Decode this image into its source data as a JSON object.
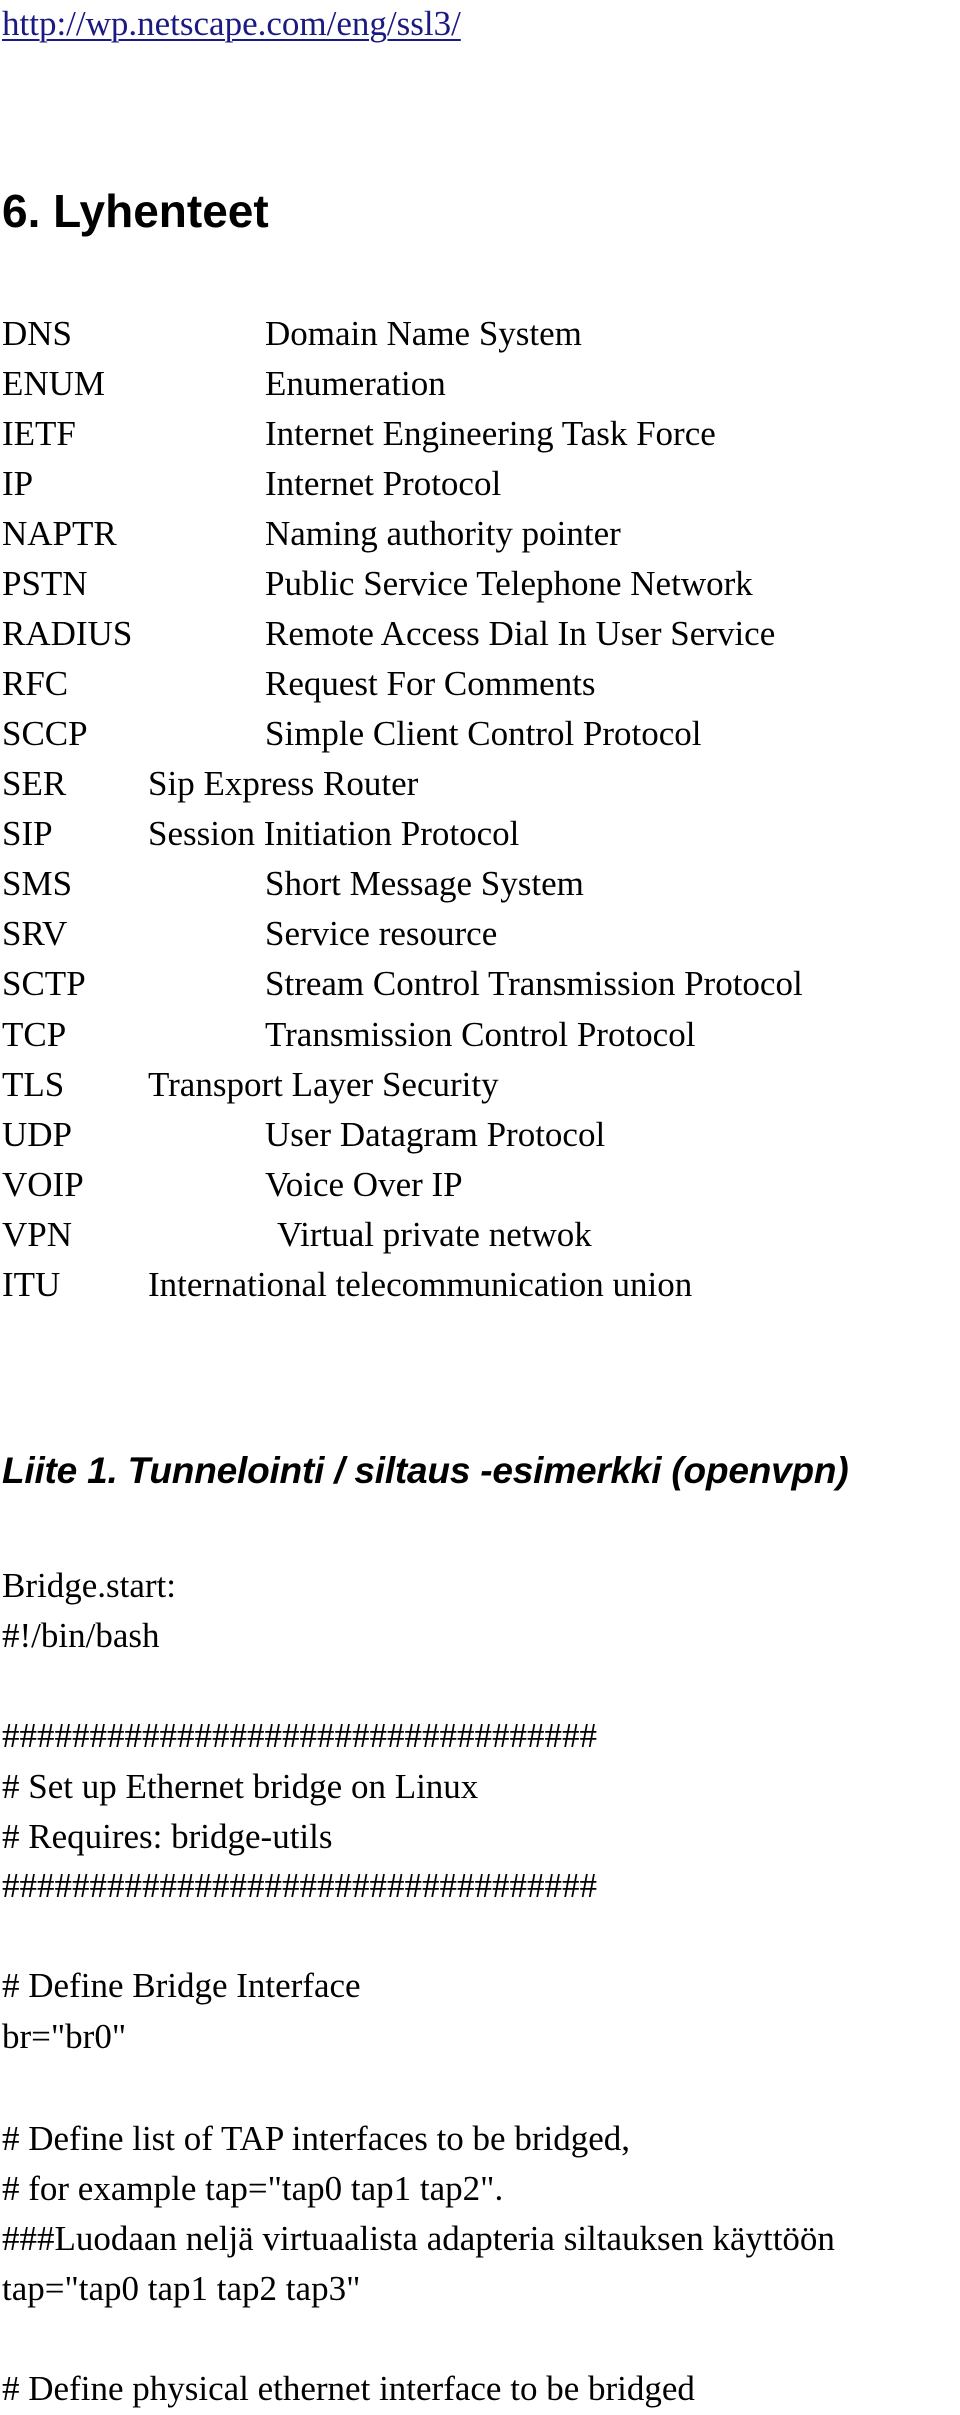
{
  "link": {
    "text": "http://wp.netscape.com/eng/ssl3/",
    "color": "#1a1a82"
  },
  "section_heading": "6. Lyhenteet",
  "abbreviations": [
    {
      "abbr": "DNS",
      "meaning": "Domain Name System"
    },
    {
      "abbr": "ENUM",
      "meaning": "Enumeration"
    },
    {
      "abbr": "IETF",
      "meaning": "Internet Engineering Task Force"
    },
    {
      "abbr": "IP",
      "meaning": "Internet Protocol"
    },
    {
      "abbr": "NAPTR",
      "meaning": "Naming authority pointer"
    },
    {
      "abbr": "PSTN",
      "meaning": "Public Service Telephone Network"
    },
    {
      "abbr": "RADIUS",
      "meaning": "Remote Access Dial In User Service"
    },
    {
      "abbr": "RFC",
      "meaning": "Request For Comments"
    },
    {
      "abbr": "SCCP",
      "meaning": "Simple Client Control Protocol"
    },
    {
      "abbr": "SER",
      "meaning": "Sip Express Router"
    },
    {
      "abbr": "SIP",
      "meaning": "Session Initiation Protocol"
    },
    {
      "abbr": "SMS",
      "meaning": "Short Message System"
    },
    {
      "abbr": "SRV",
      "meaning": "Service resource"
    },
    {
      "abbr": "SCTP",
      "meaning": "Stream Control Transmission Protocol"
    },
    {
      "abbr": "TCP",
      "meaning": "Transmission Control Protocol"
    },
    {
      "abbr": "TLS",
      "meaning": "Transport Layer Security"
    },
    {
      "abbr": "UDP",
      "meaning": "User Datagram Protocol"
    },
    {
      "abbr": "VOIP",
      "meaning": "Voice Over IP"
    },
    {
      "abbr": "VPN",
      "meaning": "Virtual private netwok"
    },
    {
      "abbr": "ITU",
      "meaning": "International telecommunication union"
    }
  ],
  "appendix_heading": "Liite 1. Tunnelointi / siltaus -esimerkki (openvpn)",
  "script_lines": [
    "Bridge.start:",
    "#!/bin/bash",
    "##################################",
    "# Set up Ethernet bridge on Linux",
    "# Requires: bridge-utils",
    "##################################",
    "# Define Bridge Interface",
    "br=\"br0\"",
    "# Define list of TAP interfaces to be bridged,",
    "# for example tap=\"tap0 tap1 tap2\".",
    "###Luodaan neljä virtuaalista adapteria siltauksen käyttöön",
    "tap=\"tap0 tap1 tap2 tap3\"",
    "# Define physical ethernet interface to be bridged"
  ]
}
